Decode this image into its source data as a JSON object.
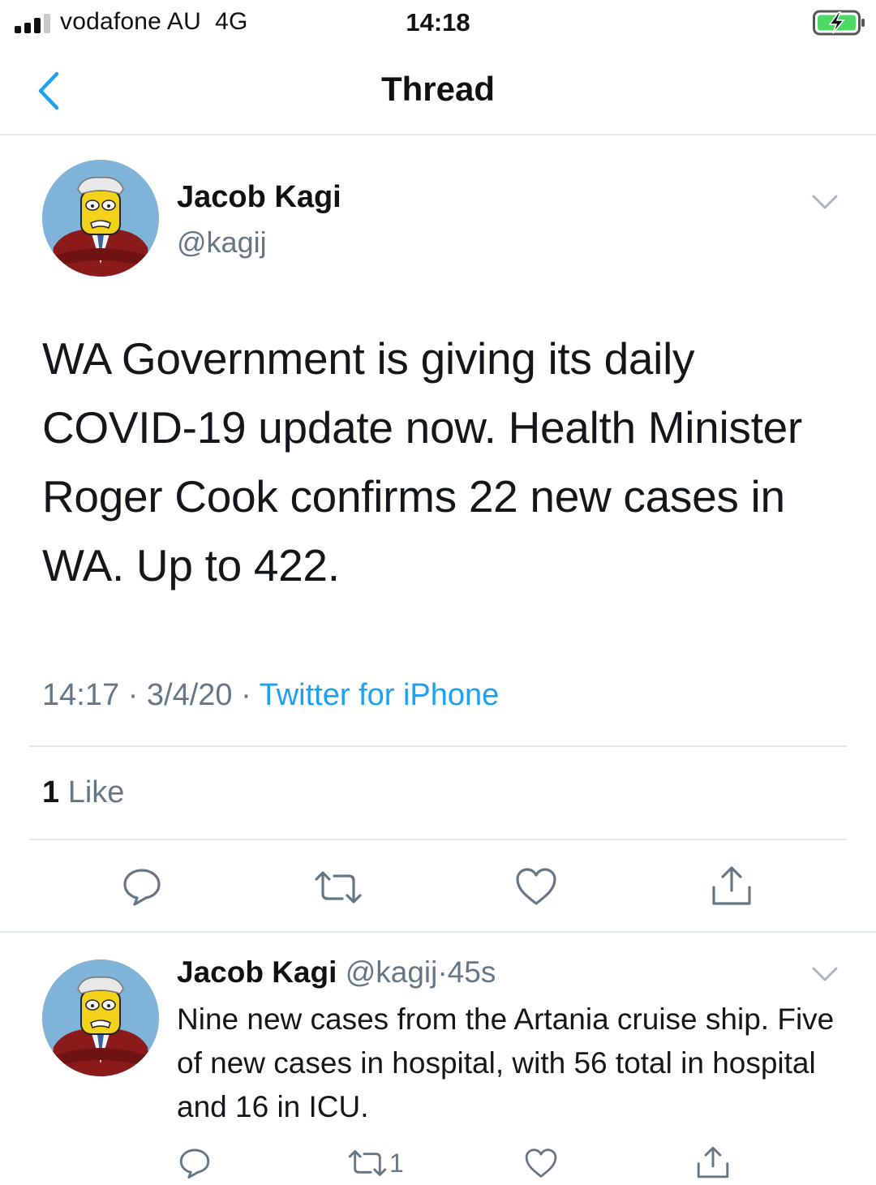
{
  "status_bar": {
    "carrier": "vodafone AU",
    "network": "4G",
    "time": "14:18"
  },
  "nav": {
    "title": "Thread"
  },
  "main_tweet": {
    "author_name": "Jacob Kagi",
    "author_handle": "@kagij",
    "text": "WA Government is giving its daily COVID-19 update now. Health Minister Roger Cook confirms 22 new cases in WA. Up to 422.",
    "time": "14:17",
    "date": "3/4/20",
    "separator": "·",
    "source": "Twitter for iPhone",
    "like_count": "1",
    "like_label": "Like"
  },
  "reply_tweet": {
    "author_name": "Jacob Kagi",
    "author_handle": "@kagij",
    "separator": "·",
    "age": "45s",
    "text": "Nine new cases from the Artania cruise ship. Five of new cases in hospital, with 56 total in hospital and 16 in ICU.",
    "retweet_count": "1"
  },
  "colors": {
    "link_blue": "#1da1f2",
    "secondary_text": "#657786",
    "divider": "#e1e8ed"
  }
}
